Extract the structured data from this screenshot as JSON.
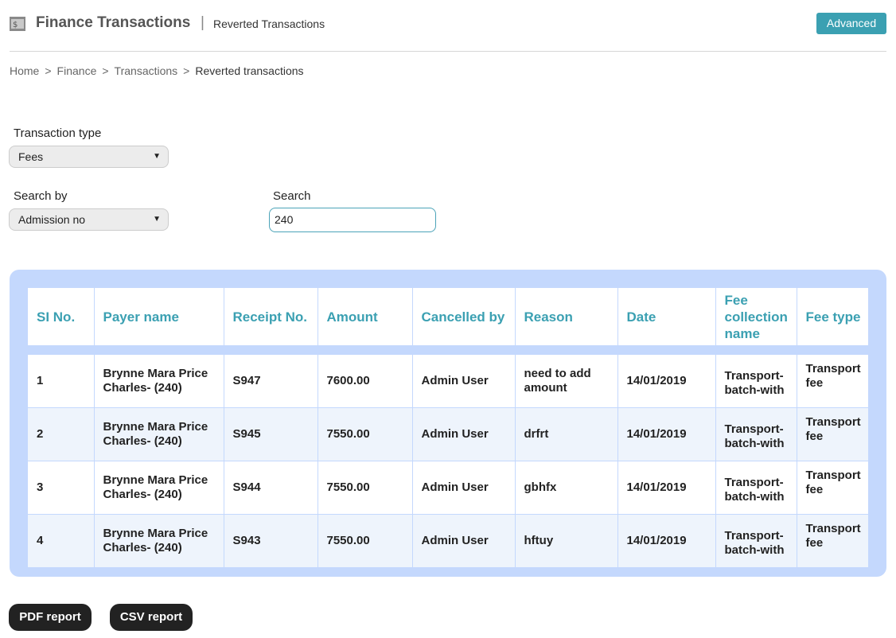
{
  "header": {
    "title": "Finance Transactions",
    "separator": "|",
    "subtitle": "Reverted Transactions",
    "advanced_label": "Advanced"
  },
  "breadcrumb": {
    "items": [
      "Home",
      "Finance",
      "Transactions"
    ],
    "separator": ">",
    "current": "Reverted transactions"
  },
  "filters": {
    "transaction_type_label": "Transaction type",
    "transaction_type_value": "Fees",
    "search_by_label": "Search by",
    "search_by_value": "Admission no",
    "search_label": "Search",
    "search_value": "240",
    "dropdown_arrow": "▼"
  },
  "table": {
    "headers": [
      "SI No.",
      "Payer name",
      "Receipt No.",
      "Amount",
      "Cancelled by",
      "Reason",
      "Date",
      "Fee collection name",
      "Fee type"
    ],
    "rows": [
      [
        "1",
        "Brynne Mara Price Charles- (240)",
        "S947",
        "7600.00",
        "Admin User",
        "need to add amount",
        "14/01/2019",
        "Transport-batch-with",
        "Transport fee"
      ],
      [
        "2",
        "Brynne Mara Price Charles- (240)",
        "S945",
        "7550.00",
        "Admin User",
        "drfrt",
        "14/01/2019",
        "Transport-batch-with",
        "Transport fee"
      ],
      [
        "3",
        "Brynne Mara Price Charles- (240)",
        "S944",
        "7550.00",
        "Admin User",
        "gbhfx",
        "14/01/2019",
        "Transport-batch-with",
        "Transport fee"
      ],
      [
        "4",
        "Brynne Mara Price Charles- (240)",
        "S943",
        "7550.00",
        "Admin User",
        "hftuy",
        "14/01/2019",
        "Transport-batch-with",
        "Transport fee"
      ]
    ]
  },
  "buttons": {
    "pdf_label": "PDF report",
    "csv_label": "CSV report"
  },
  "colors": {
    "accent": "#3ba0b2",
    "table_bg": "#c4d8fd",
    "button_dark": "#222222"
  }
}
